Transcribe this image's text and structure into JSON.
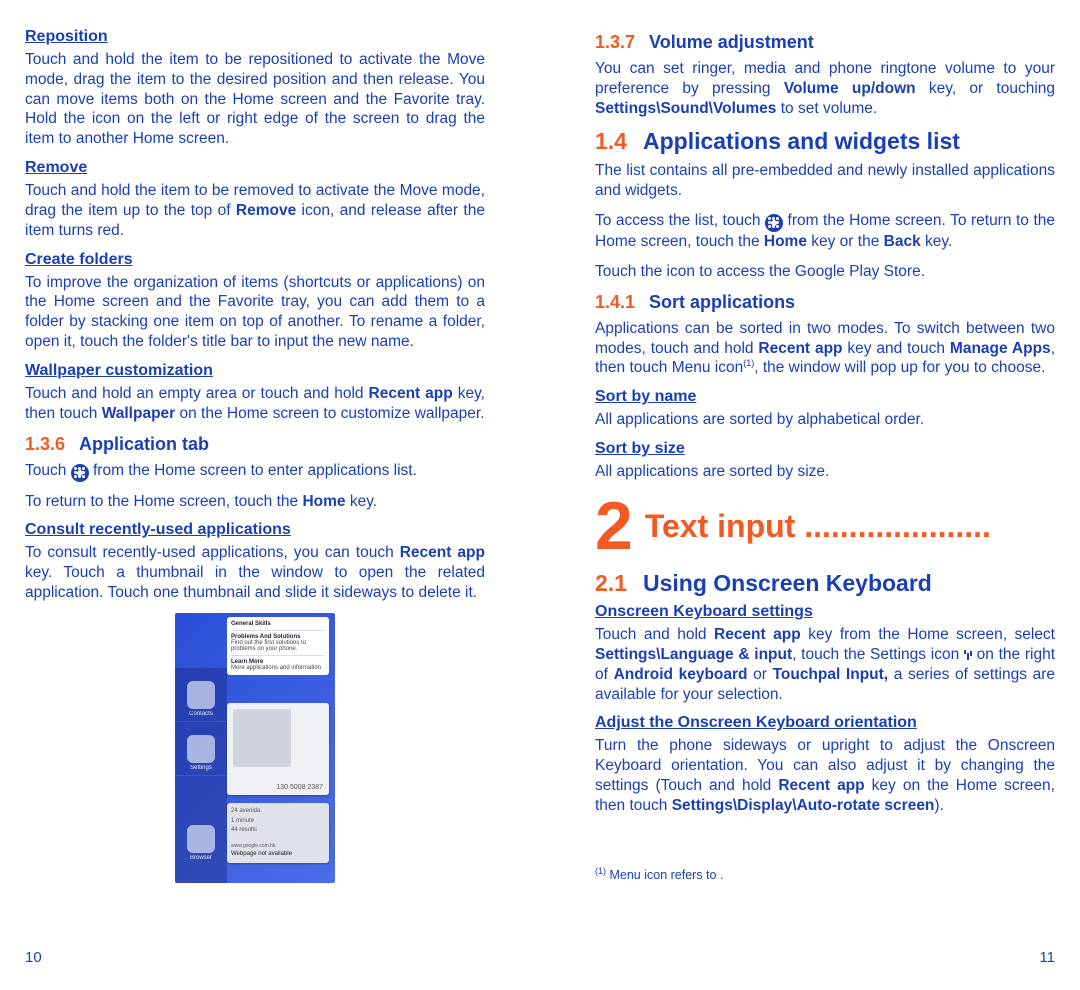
{
  "left": {
    "reposition": {
      "title": "Reposition",
      "body": "Touch and hold the item to be repositioned to activate the Move mode, drag the item to the desired position and then release. You can move items both on the Home screen and the Favorite tray. Hold the icon on the left or right edge of the screen to drag the item to another Home screen."
    },
    "remove": {
      "title": "Remove",
      "body_a": "Touch and hold the item to be removed to activate the Move mode, drag the item up to the top of ",
      "body_bold": "Remove",
      "body_b": " icon, and release after the item turns red."
    },
    "folders": {
      "title": "Create folders",
      "body": "To improve the organization of items (shortcuts or applications) on the Home screen and the Favorite tray, you can add them to a folder by stacking one item on top of another. To rename a folder, open it, touch the folder's title bar to input the new name."
    },
    "wallpaper": {
      "title": "Wallpaper customization",
      "body_a": "Touch and hold an empty area or touch and hold ",
      "body_bold1": "Recent app",
      "body_b": " key, then touch ",
      "body_bold2": "Wallpaper",
      "body_c": " on the Home screen to customize wallpaper."
    },
    "s136": {
      "num": "1.3.6",
      "title": "Application tab"
    },
    "apptab_a": "Touch ",
    "apptab_b": " from the Home screen to enter applications list.",
    "apptab_return_a": "To return to the Home screen, touch the ",
    "apptab_return_bold": "Home",
    "apptab_return_b": " key.",
    "consult": {
      "title": "Consult recently-used applications",
      "body_a": "To consult recently-used applications, you can touch ",
      "body_bold": "Recent app",
      "body_b": " key. Touch a thumbnail in the window to open the related application. Touch one thumbnail and slide it sideways to delete it."
    },
    "ss_labels": {
      "contacts": "Contacts",
      "settings": "Settings",
      "browser": "Browser"
    },
    "ss_panel": {
      "t1": "General Skills",
      "t2": "Problems And Solutions",
      "t3": "Find out the first solutions to problems on your phone.",
      "t4": "Learn More",
      "t5": "More applications and information"
    },
    "ss_phone": "130 5008 2387",
    "ss_addr_items": [
      "24 avenida",
      "1 minute",
      "44 results"
    ],
    "ss_url": "www.google.com.hk",
    "ss_not_avail": "Webpage not available",
    "pagenum": "10"
  },
  "right": {
    "s137": {
      "num": "1.3.7",
      "title": "Volume adjustment"
    },
    "vol_a": "You can set ringer, media and phone ringtone volume to your preference by pressing ",
    "vol_bold1": "Volume up/down",
    "vol_b": " key, or touching ",
    "vol_bold2": "Settings\\Sound\\Volumes",
    "vol_c": " to set volume.",
    "s14": {
      "num": "1.4",
      "title": "Applications and widgets list"
    },
    "apps_body": "The list contains all pre-embedded and newly installed applications and widgets.",
    "access_a": "To access the list, touch ",
    "access_b": " from the Home screen. To return to the Home screen, touch the ",
    "access_bold1": "Home",
    "access_c": " key or the ",
    "access_bold2": "Back",
    "access_d": " key.",
    "playstore": "Touch the icon       to access the Google Play Store.",
    "s141": {
      "num": "1.4.1",
      "title": "Sort applications"
    },
    "sort_a": "Applications can be sorted in two modes. To switch between two modes, touch and hold ",
    "sort_bold1": "Recent app",
    "sort_b": " key and touch ",
    "sort_bold2": "Manage Apps",
    "sort_c": ", then touch Menu icon",
    "sort_sup": "(1)",
    "sort_d": ", the window will pop up for you to choose.",
    "sbn": {
      "title": "Sort by name",
      "body": "All applications are sorted by alphabetical order."
    },
    "sbs": {
      "title": "Sort by size",
      "body": "All applications are sorted by size."
    },
    "chapter": {
      "num": "2",
      "title": "Text input ....................."
    },
    "s21": {
      "num": "2.1",
      "title": "Using Onscreen Keyboard"
    },
    "oks": {
      "title": "Onscreen Keyboard settings",
      "a": "Touch and hold ",
      "b1": "Recent app",
      "b": " key from the Home screen, select ",
      "b2": "Settings\\Language & input",
      "c": ", touch the Settings icon ",
      "d": " on the right of ",
      "b3": "Android keyboard",
      "e": " or ",
      "b4": "Touchpal Input,",
      "f": " a series of settings are available for your selection."
    },
    "adj": {
      "title": "Adjust the Onscreen Keyboard orientation",
      "a": "Turn the phone sideways or upright to adjust the Onscreen Keyboard orientation. You can also adjust it by changing the settings (Touch and hold ",
      "b1": "Recent app",
      "b": " key on the Home screen, then touch ",
      "b2": "Settings\\Display\\Auto-rotate screen",
      "c": ")."
    },
    "footnote_sup": "(1)",
    "footnote": "   Menu icon refers to     .",
    "pagenum": "11"
  }
}
